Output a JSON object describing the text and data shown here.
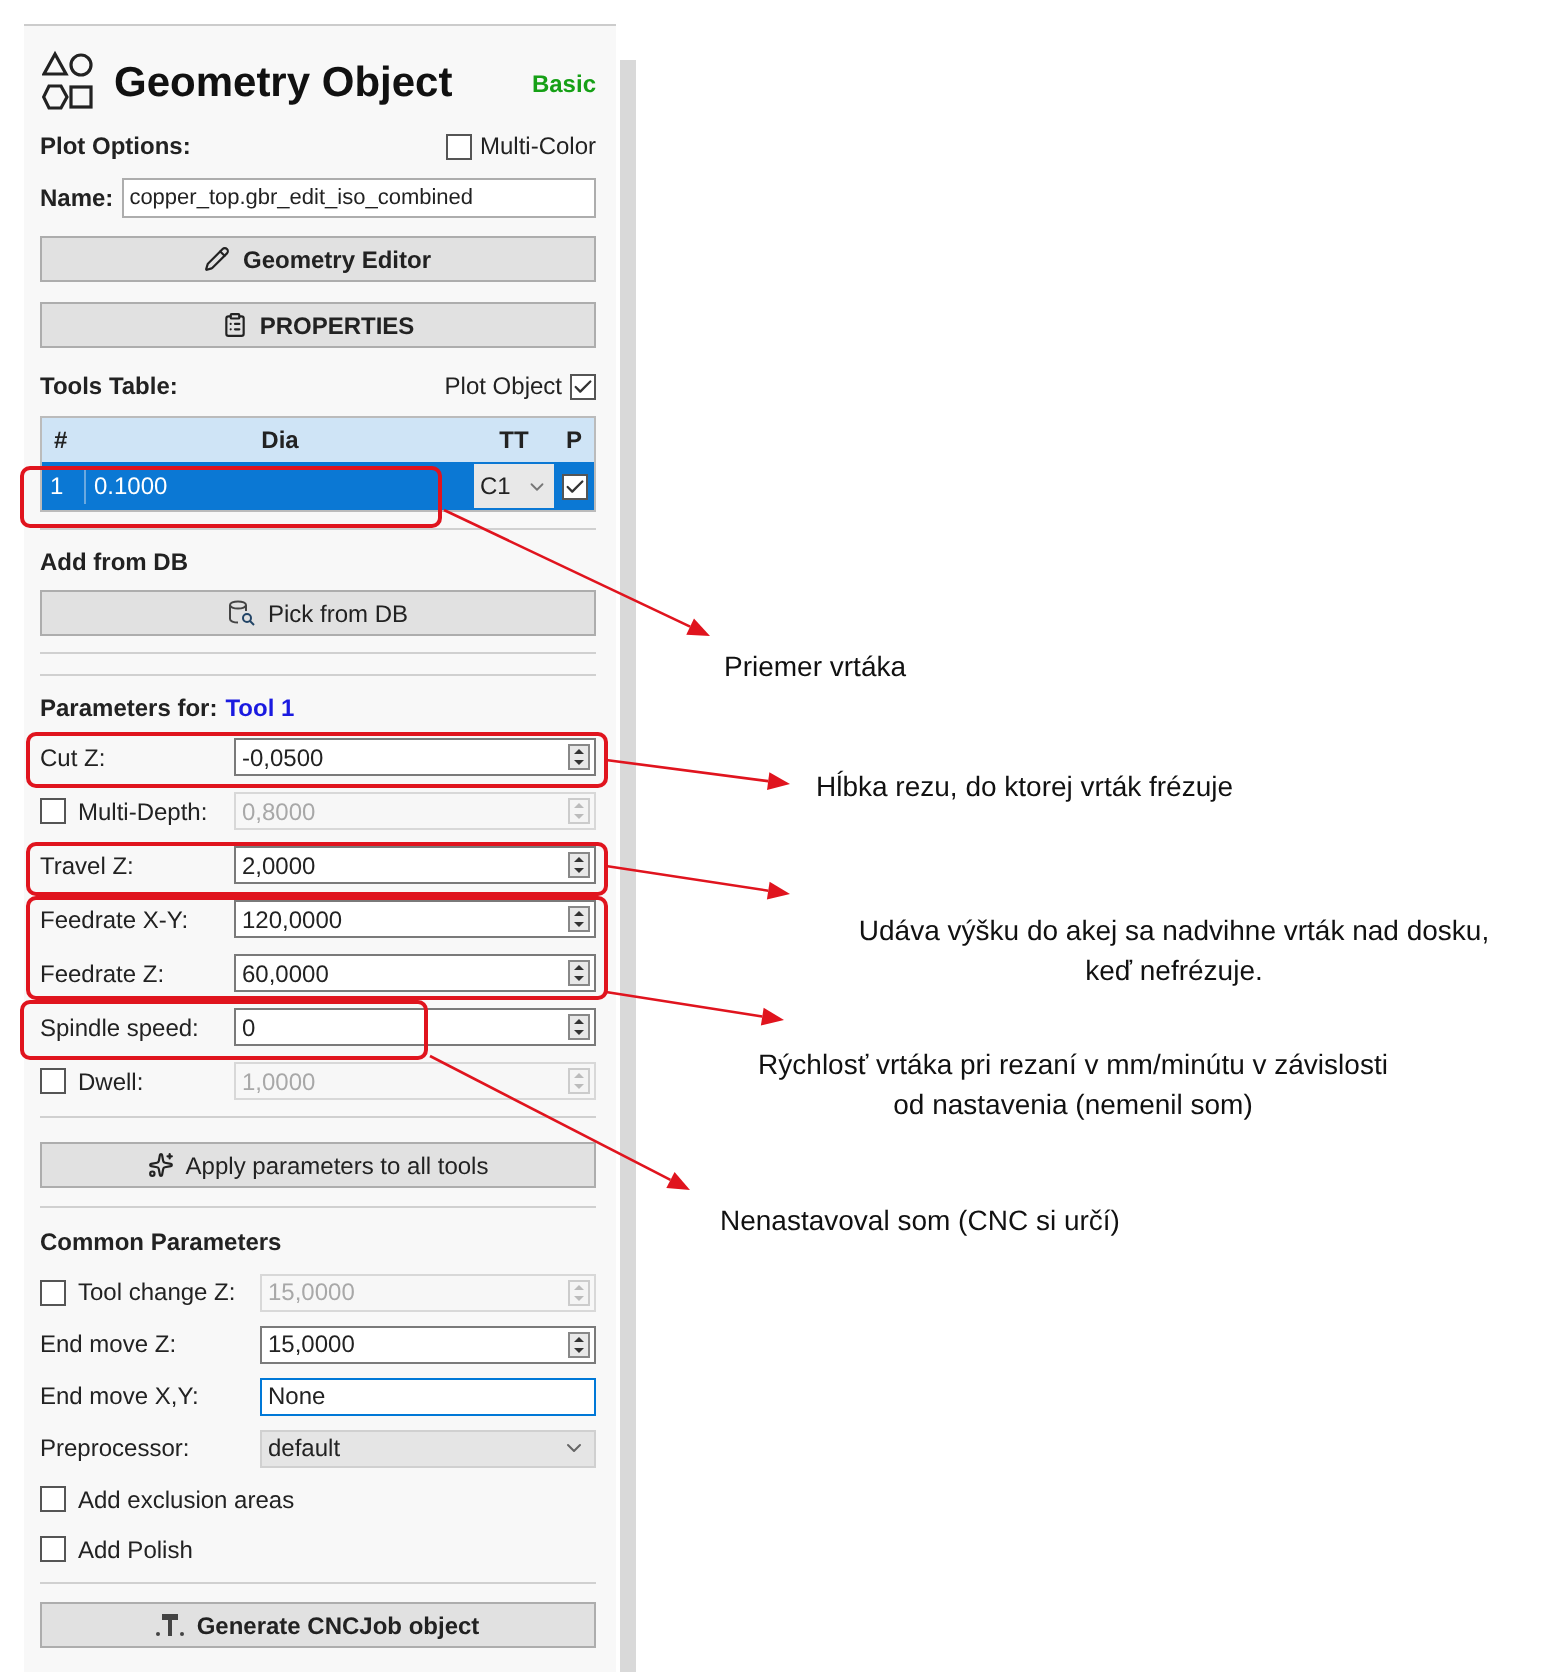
{
  "panel": {
    "title": "Geometry Object",
    "mode_badge": "Basic",
    "plot_options": {
      "label": "Plot Options:",
      "multi_color": {
        "label": "Multi-Color",
        "checked": false
      }
    },
    "name": {
      "label": "Name:",
      "value": "copper_top.gbr_edit_iso_combined"
    },
    "buttons_top": [
      {
        "kind": "editor",
        "label": "Geometry Editor"
      },
      {
        "kind": "properties",
        "label": "PROPERTIES"
      }
    ],
    "tools_table": {
      "label": "Tools Table:",
      "plot_object": {
        "label": "Plot Object",
        "checked": true
      },
      "columns": [
        "#",
        "Dia",
        "TT",
        "P"
      ],
      "rows": [
        {
          "number": "1",
          "dia": "0.1000",
          "tt": "C1",
          "plot": true,
          "selected": true
        }
      ]
    },
    "add_from_db": {
      "label": "Add from DB",
      "button": "Pick from DB"
    },
    "parameters": {
      "label": "Parameters for:",
      "tool": "Tool 1",
      "rows": [
        {
          "kind": "spin",
          "label": "Cut Z:",
          "value": "-0,0500"
        },
        {
          "kind": "check_spin",
          "label": "Multi-Depth:",
          "value": "0,8000",
          "checked": false
        },
        {
          "kind": "spin",
          "label": "Travel Z:",
          "value": "2,0000"
        },
        {
          "kind": "spin",
          "label": "Feedrate X-Y:",
          "value": "120,0000"
        },
        {
          "kind": "spin",
          "label": "Feedrate Z:",
          "value": "60,0000"
        },
        {
          "kind": "spin",
          "label": "Spindle speed:",
          "value": "0"
        },
        {
          "kind": "check_spin",
          "label": "Dwell:",
          "value": "1,0000",
          "checked": false
        }
      ]
    },
    "apply_button": "Apply parameters to all tools",
    "common": {
      "label": "Common Parameters",
      "rows": [
        {
          "kind": "check_spin",
          "label": "Tool change Z:",
          "value": "15,0000",
          "checked": false
        },
        {
          "kind": "spin",
          "label": "End move Z:",
          "value": "15,0000"
        },
        {
          "kind": "text",
          "label": "End move X,Y:",
          "value": "None",
          "focused": true
        },
        {
          "kind": "select",
          "label": "Preprocessor:",
          "value": "default"
        },
        {
          "kind": "check",
          "label": "Add exclusion areas",
          "checked": false
        },
        {
          "kind": "check",
          "label": "Add Polish",
          "checked": false
        }
      ]
    },
    "generate_button": "Generate CNCJob object"
  },
  "annotations": [
    {
      "text": "Priemer vrtáka"
    },
    {
      "text": "Hĺbka rezu, do ktorej vrták frézuje"
    },
    {
      "text": "Udáva výšku do akej sa nadvihne vrták nad dosku, keď nefrézuje."
    },
    {
      "text": "Rýchlosť vrtáka pri rezaní v mm/minútu v závislosti od nastavenia (nemenil som)"
    },
    {
      "text": "Nenastavoval som (CNC si určí)"
    }
  ]
}
